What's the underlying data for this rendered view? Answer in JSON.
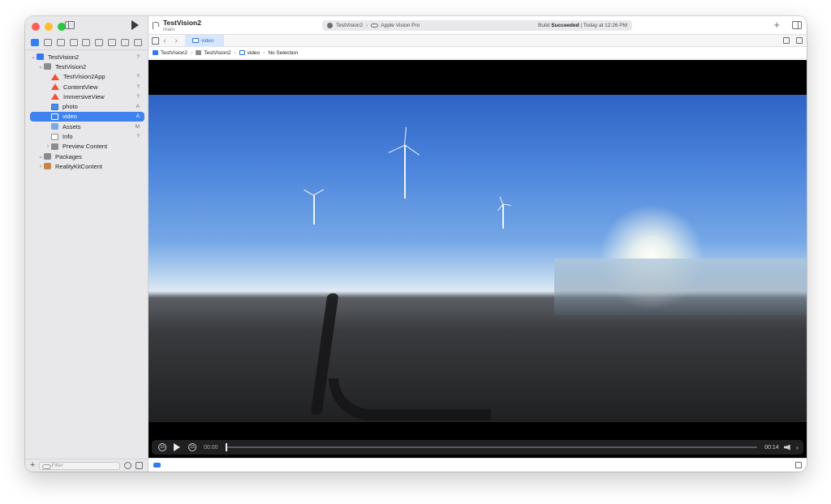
{
  "window": {
    "traffic_lights": {
      "close": "#ff5f57",
      "minimize": "#febc2e",
      "zoom": "#28c840"
    }
  },
  "toolbar": {
    "project_name": "TestVision2",
    "branch": "main",
    "scheme": "TestVision2",
    "destination": "Apple Vision Pro",
    "build_status_prefix": "Build",
    "build_status_bold": "Succeeded",
    "build_status_suffix": "| Today at 12:26 PM"
  },
  "navigator": {
    "tree": [
      {
        "label": "TestVision2",
        "badge": "?",
        "icon": "app-icon",
        "level": 0,
        "chevron": "⌄"
      },
      {
        "label": "TestVision2",
        "badge": "",
        "icon": "folder-icon",
        "level": 1,
        "chevron": "⌄"
      },
      {
        "label": "TestVision2App",
        "badge": "?",
        "icon": "swift-file-icon",
        "level": 2,
        "chevron": ""
      },
      {
        "label": "ContentView",
        "badge": "?",
        "icon": "swift-file-icon",
        "level": 2,
        "chevron": ""
      },
      {
        "label": "ImmersiveView",
        "badge": "?",
        "icon": "swift-file-icon",
        "level": 2,
        "chevron": ""
      },
      {
        "label": "photo",
        "badge": "A",
        "icon": "image-file-icon",
        "level": 2,
        "chevron": ""
      },
      {
        "label": "video",
        "badge": "A",
        "icon": "video-file-icon",
        "level": 2,
        "chevron": "",
        "selected": true
      },
      {
        "label": "Assets",
        "badge": "M",
        "icon": "asset-catalog-icon",
        "level": 2,
        "chevron": ""
      },
      {
        "label": "Info",
        "badge": "?",
        "icon": "plist-icon",
        "level": 2,
        "chevron": ""
      },
      {
        "label": "Preview Content",
        "badge": "",
        "icon": "folder-icon",
        "level": 2,
        "chevron": "›"
      },
      {
        "label": "Packages",
        "badge": "",
        "icon": "folder-icon",
        "level": 1,
        "chevron": "⌄"
      },
      {
        "label": "RealityKitContent",
        "badge": "",
        "icon": "package-icon",
        "level": 1,
        "chevron": "›"
      }
    ],
    "filter_placeholder": "Filter"
  },
  "tabbar": {
    "active_tab": "video"
  },
  "jumpbar": {
    "items": [
      "TestVision2",
      "TestVision2",
      "video",
      "No Selection"
    ]
  },
  "player": {
    "current_time": "00:00",
    "total_time": "00:14",
    "progress": 0.0,
    "skip_back_label": "15",
    "skip_forward_label": "15"
  },
  "colors": {
    "accent": "#3f82f0",
    "swift": "#f05138"
  }
}
